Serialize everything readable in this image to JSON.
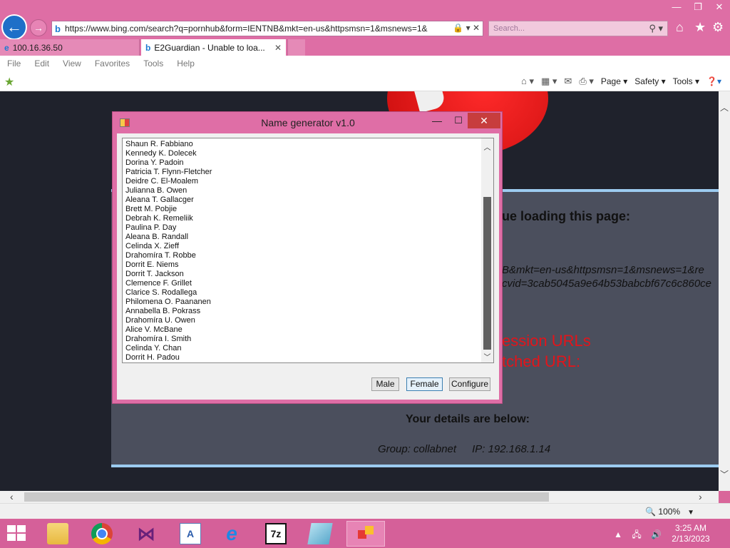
{
  "browser": {
    "address_url": "https://www.bing.com/search?q=pornhub&form=IENTNB&mkt=en-us&httpsmsn=1&msnews=1&",
    "search_placeholder": "Search...",
    "tabs": [
      {
        "label": "100.16.36.50",
        "icon": "ie-icon"
      },
      {
        "label": "E2Guardian - Unable to loa...",
        "icon": "bing-icon"
      }
    ],
    "menu": [
      "File",
      "Edit",
      "View",
      "Favorites",
      "Tools",
      "Help"
    ],
    "command_bar": {
      "page": "Page",
      "safety": "Safety",
      "tools": "Tools"
    },
    "zoom": "100%"
  },
  "page": {
    "heading_fragment": "ue loading this page:",
    "url_line1": "B&mkt=en-us&httpsmsn=1&msnews=1&re",
    "url_line2": "cvid=3cab5045a9e64b53babcbf67c6c860ce",
    "red_line1": "ession URLs",
    "red_line2": "tched URL:",
    "details_heading": "Your details are below:",
    "group_label": "Group: collabnet",
    "ip_label": "IP: 192.168.1.14"
  },
  "dialog": {
    "title": "Name generator v1.0",
    "names": [
      "Shaun R. Fabbiano",
      "Kennedy K. Dolecek",
      "Dorina Y. Padoin",
      "Patricia T. Flynn-Fletcher",
      "Deidre C. El-Moalem",
      "Julianna B. Owen",
      "Aleana T. Gallacger",
      "Brett M. Pobjie",
      "Debrah K. Remeliik",
      "Paulina P. Day",
      "Aleana B. Randall",
      "Celinda X. Zieff",
      "Drahomíra T. Robbe",
      "Dorrit E. Niems",
      "Dorrit T. Jackson",
      "Clemence F. Grillet",
      "Clarice S. Rodallega",
      "Philomena O. Paananen",
      "Annabella B. Pokrass",
      "Drahomíra U. Owen",
      "Alice V. McBane",
      "Drahomíra I. Smith",
      "Celinda Y. Chan",
      "Dorrit H. Padou"
    ],
    "buttons": {
      "male": "Male",
      "female": "Female",
      "configure": "Configure"
    }
  },
  "taskbar": {
    "time": "3:25 AM",
    "date": "2/13/2023"
  },
  "colors": {
    "chrome_pink": "#de6ea5",
    "page_bg": "#1f222c",
    "panel_bg": "#4b4f5d",
    "panel_border": "#9ccbef",
    "error_red": "#e3141a",
    "close_red": "#c73d3d"
  }
}
